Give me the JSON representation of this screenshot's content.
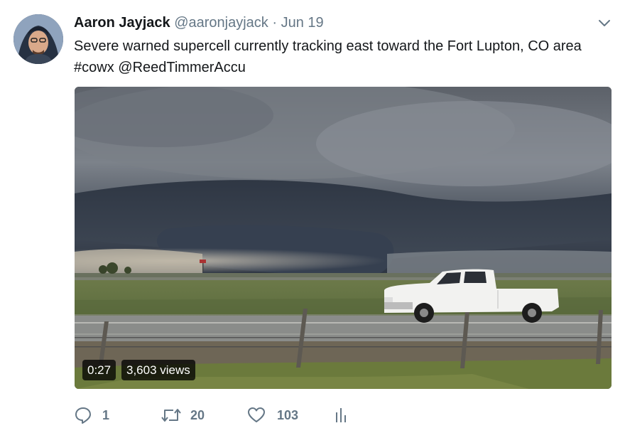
{
  "tweet": {
    "author_name": "Aaron Jayjack",
    "handle": "@aaronjayjack",
    "separator": "·",
    "date": "Jun 19",
    "text_main": "Severe warned supercell currently tracking east toward the Fort Lupton, CO area",
    "hashtag": "#cowx",
    "mention": "@ReedTimmerAccu",
    "menu_icon": "chevron-down-icon"
  },
  "video": {
    "duration": "0:27",
    "views": "3,603 views"
  },
  "actions": {
    "replies": "1",
    "retweets": "20",
    "likes": "103",
    "reply_icon": "reply-icon",
    "retweet_icon": "retweet-icon",
    "like_icon": "heart-icon",
    "analytics_icon": "analytics-icon"
  },
  "colors": {
    "text": "#14171a",
    "secondary": "#657786"
  }
}
